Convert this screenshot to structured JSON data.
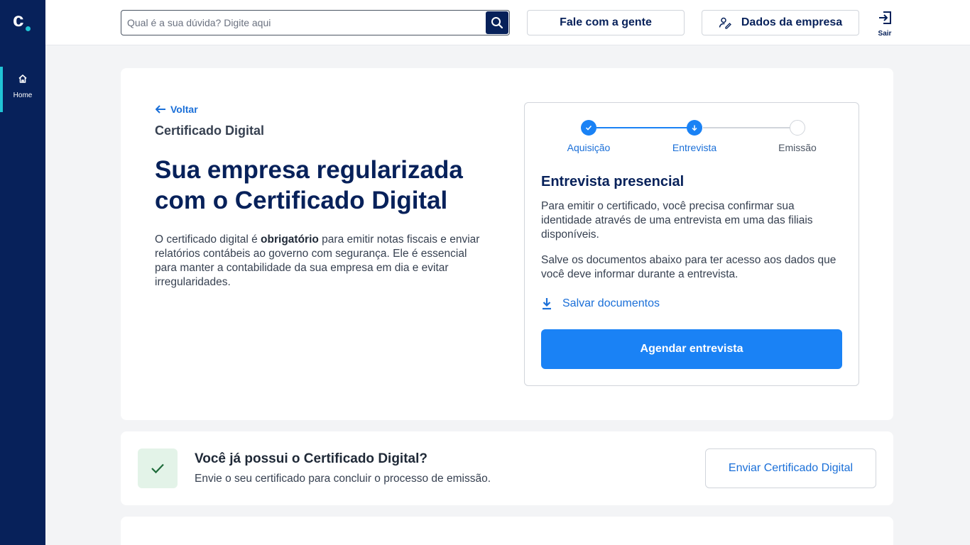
{
  "brand": {
    "logo_letter": "c",
    "accent": "#20c4d6",
    "navy": "#07215a",
    "blue": "#1a82f5"
  },
  "sidebar": {
    "items": [
      {
        "label": "Home",
        "icon": "home-icon",
        "active": true
      }
    ]
  },
  "header": {
    "search_placeholder": "Qual é a sua dúvida? Digite aqui",
    "talk_label": "Fale com a gente",
    "company_label": "Dados da empresa",
    "logout_label": "Sair"
  },
  "main": {
    "back_label": "Voltar",
    "subtitle": "Certificado Digital",
    "headline": "Sua empresa regularizada com o Certificado Digital",
    "desc_before": "O certificado digital é ",
    "desc_bold": "obrigatório",
    "desc_after": " para emitir notas fiscais e enviar relatórios contábeis ao governo com segurança. Ele é essencial para manter a contabilidade da sua empresa em dia e evitar irregularidades."
  },
  "stepper": {
    "steps": [
      {
        "label": "Aquisição",
        "state": "done"
      },
      {
        "label": "Entrevista",
        "state": "current"
      },
      {
        "label": "Emissão",
        "state": "pending"
      }
    ]
  },
  "panel": {
    "title": "Entrevista presencial",
    "text1": "Para emitir o certificado, você precisa confirmar sua identidade através de uma entrevista em uma das filiais disponíveis.",
    "text2": "Salve os documentos abaixo para ter acesso aos dados que você deve informar durante a entrevista.",
    "save_label": "Salvar documentos",
    "cta_label": "Agendar entrevista"
  },
  "card2": {
    "title": "Você já possui o Certificado Digital?",
    "text": "Envie o seu certificado para concluir o processo de emissão.",
    "button_label": "Enviar Certificado Digital"
  }
}
